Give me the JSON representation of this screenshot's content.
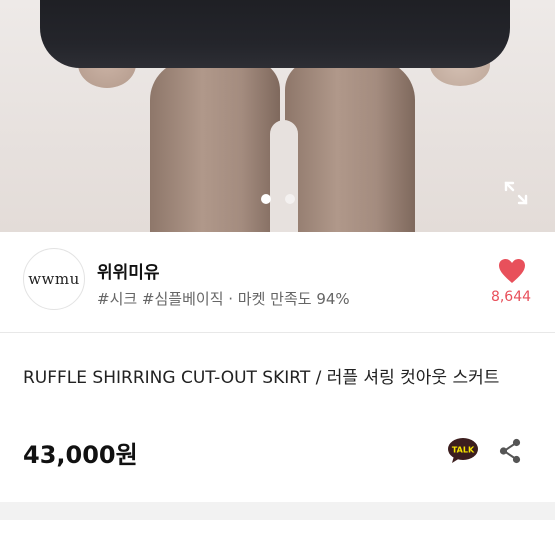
{
  "photo": {
    "slides_total": 2,
    "active_slide": 1
  },
  "seller": {
    "logo_text": "wwmu",
    "name": "위위미유",
    "tags": "#시크 #심플베이직 · 마켓 만족도 94%",
    "like_count": "8,644"
  },
  "product": {
    "title": "RUFFLE SHIRRING CUT-OUT SKIRT / 러플 셔링 컷아웃 스커트",
    "price": "43,000원",
    "talk_label": "TALK"
  },
  "icons": {
    "expand": "expand-icon",
    "heart": "heart-icon",
    "talk": "kakaotalk-icon",
    "share": "share-icon"
  },
  "colors": {
    "heart": "#e8505b",
    "talk_bubble": "#3c1e1e"
  }
}
